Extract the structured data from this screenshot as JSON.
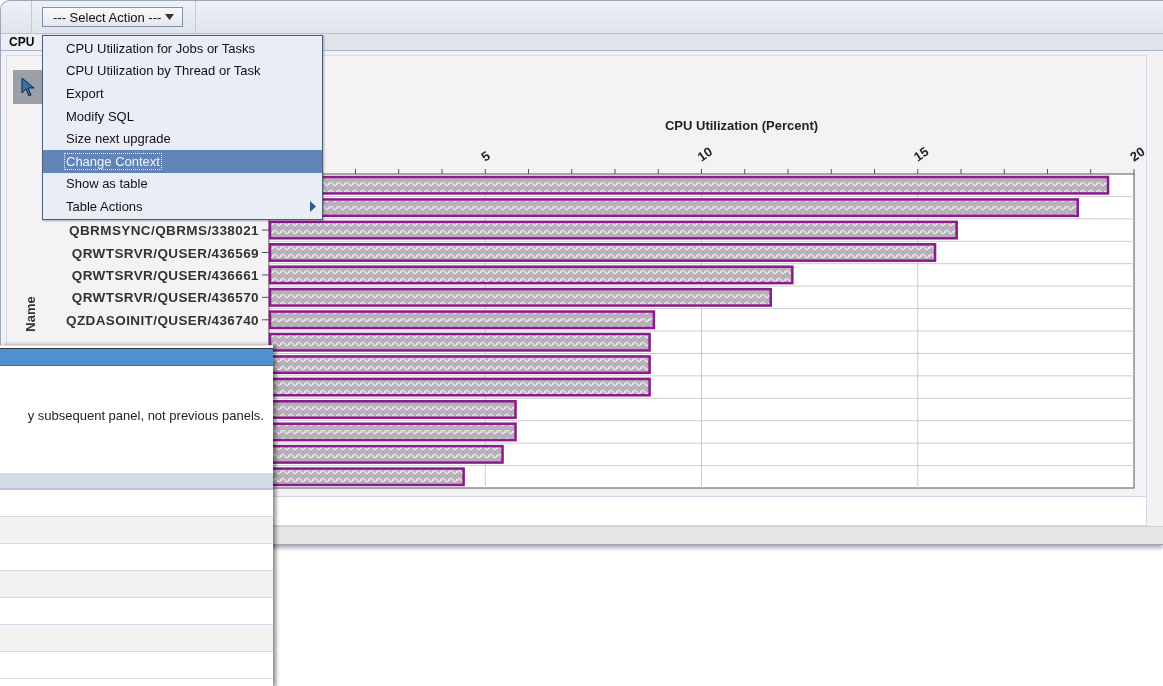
{
  "toolbar": {
    "action_select": "--- Select Action ---"
  },
  "tabs": [
    {
      "label": "CPU",
      "selected": true
    }
  ],
  "action_menu": {
    "items": [
      {
        "label": "CPU Utilization for Jobs or Tasks",
        "kind": "plain",
        "selected": false
      },
      {
        "label": "CPU Utilization by Thread or Task",
        "kind": "plain",
        "selected": false
      },
      {
        "label": "Export",
        "kind": "plain",
        "selected": false
      },
      {
        "label": "Modify SQL",
        "kind": "plain",
        "selected": false
      },
      {
        "label": "Size next upgrade",
        "kind": "plain",
        "selected": false
      },
      {
        "label": "Change Context",
        "kind": "plain",
        "selected": true
      },
      {
        "label": "Show as table",
        "kind": "plain",
        "selected": false
      },
      {
        "label": "Table Actions",
        "kind": "submenu",
        "selected": false
      }
    ]
  },
  "chart": {
    "chart_data": {
      "type": "bar",
      "orientation": "horizontal",
      "title": "CPU Utilization (Percent)",
      "ylabel": "Name",
      "categories": [
        null,
        null,
        "QBRMSYNC/QBRMS/338021",
        "QRWTSRVR/QUSER/436569",
        "QRWTSRVR/QUSER/436661",
        "QRWTSRVR/QUSER/436570",
        "QZDASOINIT/QUSER/436740",
        null,
        null,
        null,
        null,
        null,
        null,
        null
      ],
      "series": [
        {
          "color": "#8b1a8b",
          "values": [
            19.4,
            18.7,
            15.9,
            15.4,
            12.1,
            11.6,
            8.9,
            8.8,
            8.8,
            8.8,
            5.7,
            5.7,
            5.4,
            4.5
          ]
        }
      ],
      "xlim": [
        0,
        20
      ],
      "xticks": [
        5,
        10,
        15,
        20
      ],
      "grid": true
    }
  },
  "dialog": {
    "message": "y subsequent panel, not previous panels."
  }
}
